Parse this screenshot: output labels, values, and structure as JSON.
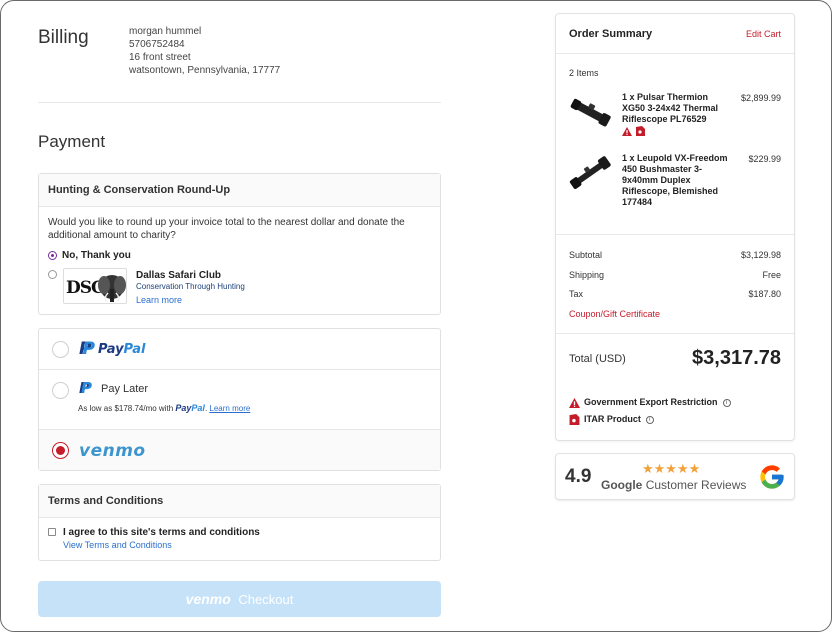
{
  "billing": {
    "title": "Billing",
    "name": "morgan hummel",
    "phone": "5706752484",
    "street": "16 front street",
    "city": "watsontown, Pennsylvania, 17777"
  },
  "payment": {
    "title": "Payment",
    "roundup": {
      "header": "Hunting & Conservation Round-Up",
      "question": "Would you like to round up your invoice total to the nearest dollar and donate the additional amount to charity?",
      "option_no": "No, Thank you",
      "charity_logo_text": "DSC",
      "charity_name": "Dallas Safari Club",
      "charity_tagline": "Conservation Through Hunting",
      "learn_more": "Learn more"
    },
    "methods": {
      "paypal_pay": "Pay",
      "paypal_pal": "Pal",
      "paylater_label": "Pay Later",
      "aslow_prefix": "As low as $178.74/mo with",
      "aslow_pay": "Pay",
      "aslow_pal": "Pal",
      "aslow_suffix": ".",
      "aslow_learn": "Learn more",
      "venmo": "venmo",
      "selected": "venmo"
    },
    "terms": {
      "header": "Terms and Conditions",
      "agree": "I agree to this site's terms and conditions",
      "view_link": "View Terms and Conditions"
    },
    "checkout": {
      "brand": "venmo",
      "label": "Checkout"
    }
  },
  "summary": {
    "title": "Order Summary",
    "edit_cart": "Edit Cart",
    "items_count": "2 Items",
    "items": [
      {
        "name": "1 x Pulsar Thermion XG50 3-24x42 Thermal Riflescope PL76529",
        "price": "$2,899.99"
      },
      {
        "name": "1 x Leupold VX-Freedom 450 Bushmaster 3-9x40mm Duplex Riflescope, Blemished 177484",
        "price": "$229.99"
      }
    ],
    "subtotal_label": "Subtotal",
    "subtotal": "$3,129.98",
    "shipping_label": "Shipping",
    "shipping": "Free",
    "tax_label": "Tax",
    "tax": "$187.80",
    "coupon": "Coupon/Gift Certificate",
    "total_label": "Total (USD)",
    "total": "$3,317.78",
    "notice_export": "Government Export Restriction",
    "notice_itar": "ITAR Product"
  },
  "reviews": {
    "score": "4.9",
    "stars": "★★★★★",
    "google": "Google",
    "label": "Customer Reviews"
  },
  "colors": {
    "accent_red": "#c51c2a",
    "link_blue": "#2a6fcf",
    "venmo_blue": "#3d95ce",
    "checkout_bg": "#c5e2f9"
  }
}
